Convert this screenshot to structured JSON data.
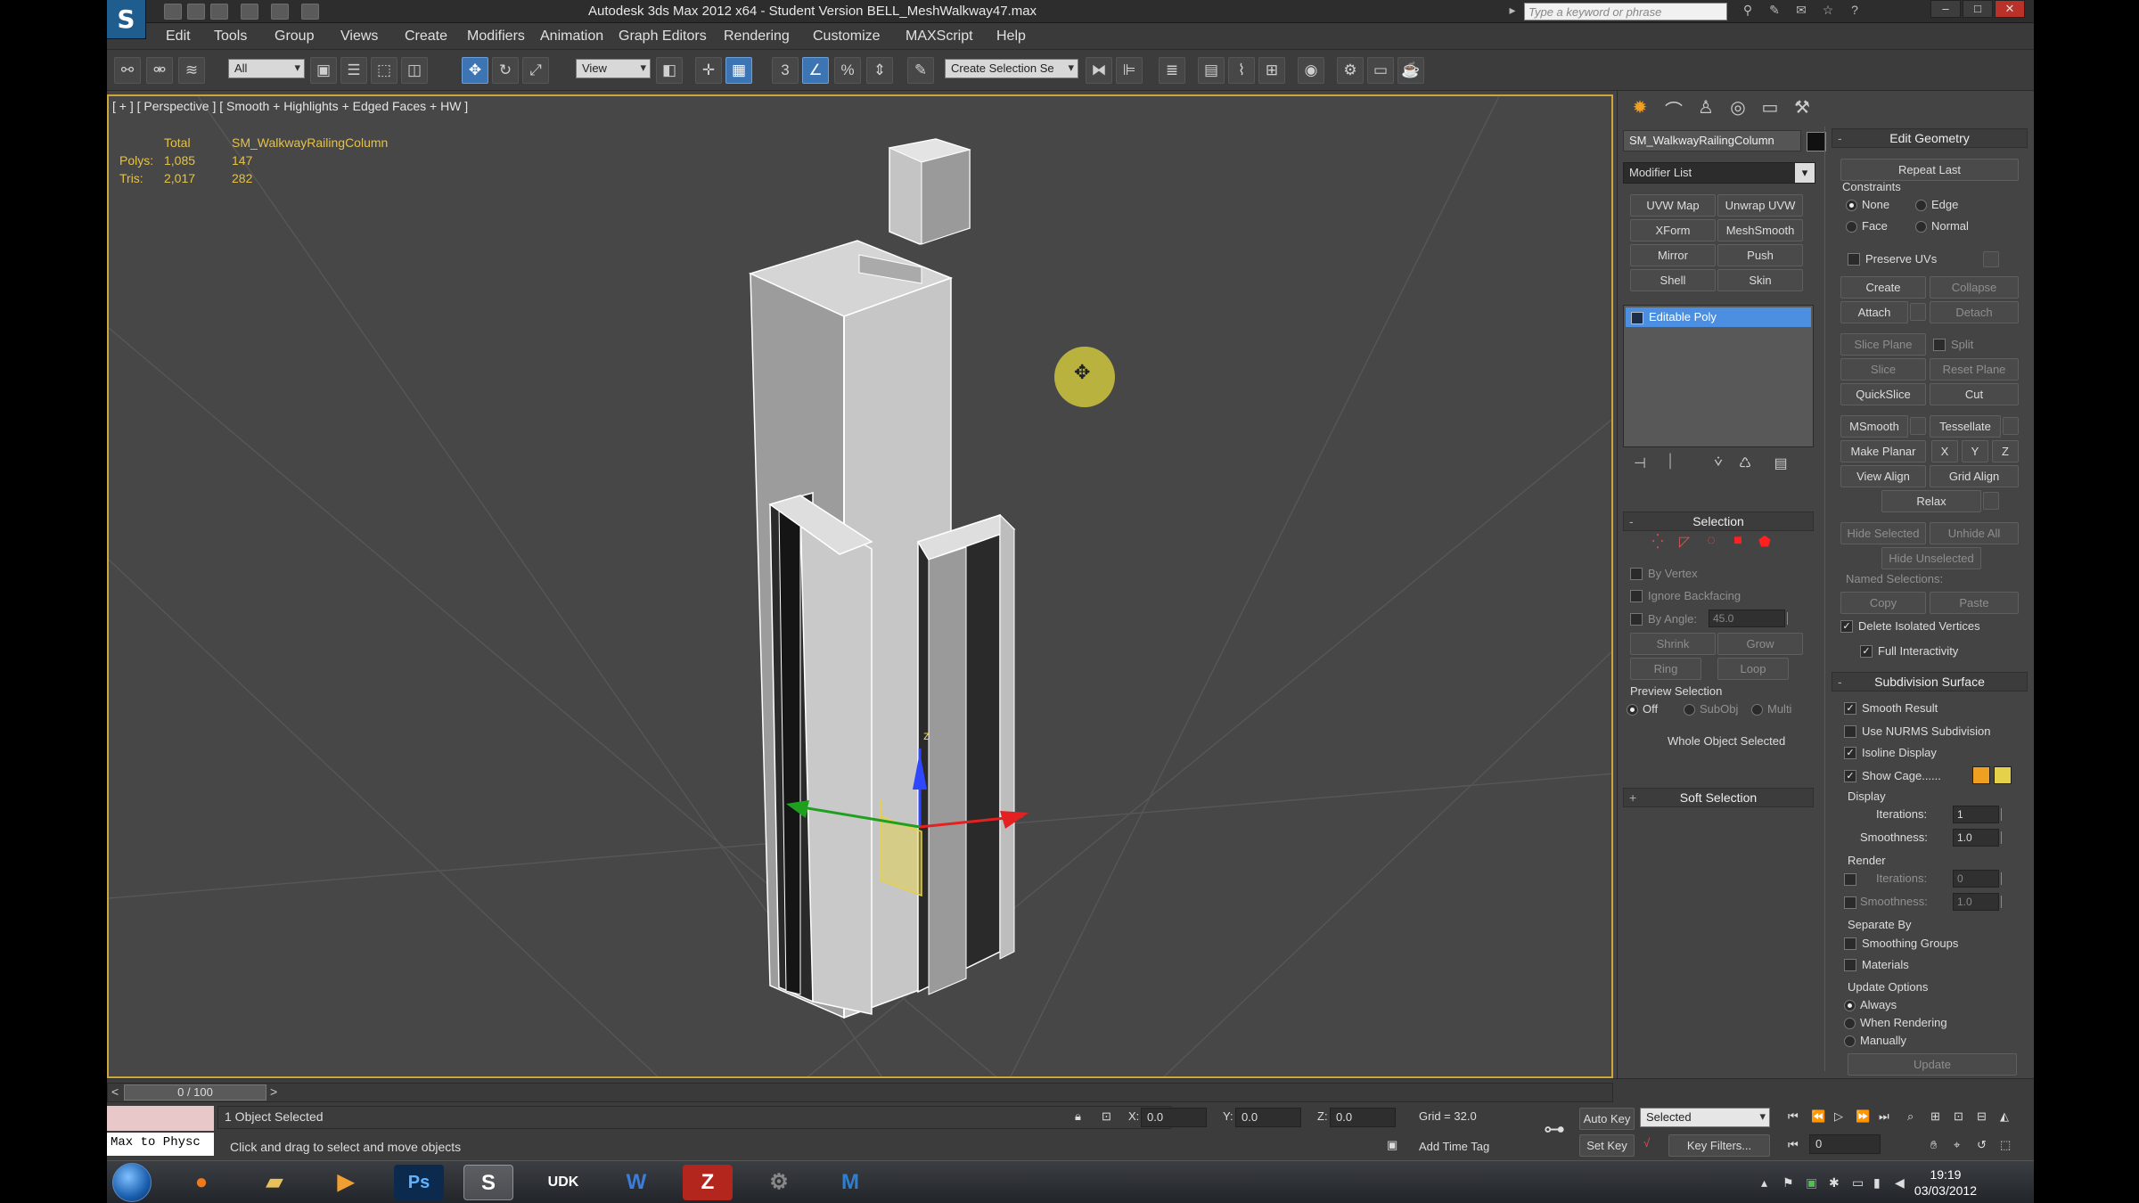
{
  "window": {
    "title": "Autodesk 3ds Max 2012 x64  -  Student Version    BELL_MeshWalkway47.max",
    "search_placeholder": "Type a keyword or phrase"
  },
  "menus": [
    "Edit",
    "Tools",
    "Group",
    "Views",
    "Create",
    "Modifiers",
    "Animation",
    "Graph Editors",
    "Rendering",
    "Customize",
    "MAXScript",
    "Help"
  ],
  "toolbar": {
    "selection_filter": "All",
    "ref_coord": "View",
    "named_selection": "Create Selection Se",
    "snap_label": "3"
  },
  "viewport": {
    "label": "[ + ] [ Perspective ] [ Smooth + Highlights + Edged Faces + HW ]",
    "stats": {
      "header_total": "Total",
      "header_object": "SM_WalkwayRailingColumn",
      "polys_label": "Polys:",
      "polys_total": "1,085",
      "polys_object": "147",
      "tris_label": "Tris:",
      "tris_total": "2,017",
      "tris_object": "282"
    },
    "gizmo_z_label": "z"
  },
  "command_panel": {
    "object_name": "SM_WalkwayRailingColumn",
    "modifier_list": "Modifier List",
    "modifier_buttons": [
      "UVW Map",
      "Unwrap UVW",
      "XForm",
      "MeshSmooth",
      "Mirror",
      "Push",
      "Shell",
      "Skin"
    ],
    "stack_item": "Editable Poly",
    "selection": {
      "title": "Selection",
      "by_vertex": "By Vertex",
      "ignore_backfacing": "Ignore Backfacing",
      "by_angle": "By Angle:",
      "angle_value": "45.0",
      "shrink": "Shrink",
      "grow": "Grow",
      "ring": "Ring",
      "loop": "Loop",
      "preview_title": "Preview Selection",
      "preview_options": [
        "Off",
        "SubObj",
        "Multi"
      ],
      "status": "Whole Object Selected"
    },
    "soft_selection": "Soft Selection",
    "edit_geometry": {
      "title": "Edit Geometry",
      "repeat_last": "Repeat Last",
      "constraints": "Constraints",
      "constraint_options": [
        "None",
        "Edge",
        "Face",
        "Normal"
      ],
      "preserve_uvs": "Preserve UVs",
      "create": "Create",
      "collapse": "Collapse",
      "attach": "Attach",
      "detach": "Detach",
      "slice_plane": "Slice Plane",
      "split": "Split",
      "slice": "Slice",
      "reset_plane": "Reset Plane",
      "quickslice": "QuickSlice",
      "cut": "Cut",
      "msmooth": "MSmooth",
      "tessellate": "Tessellate",
      "make_planar": "Make Planar",
      "x": "X",
      "y": "Y",
      "z": "Z",
      "view_align": "View Align",
      "grid_align": "Grid Align",
      "relax": "Relax",
      "hide_selected": "Hide Selected",
      "unhide_all": "Unhide All",
      "hide_unselected": "Hide Unselected",
      "named_selections": "Named Selections:",
      "copy": "Copy",
      "paste": "Paste",
      "delete_isolated": "Delete Isolated Vertices",
      "full_interactivity": "Full Interactivity"
    },
    "subdivision": {
      "title": "Subdivision Surface",
      "smooth_result": "Smooth Result",
      "use_nurms": "Use NURMS Subdivision",
      "isoline": "Isoline Display",
      "show_cage": "Show Cage......",
      "cage_color_1": "#f0a020",
      "cage_color_2": "#e6d24a",
      "display": "Display",
      "iterations": "Iterations:",
      "iterations_value": "1",
      "smoothness": "Smoothness:",
      "smoothness_value": "1.0",
      "render": "Render",
      "render_iterations_value": "0",
      "render_smoothness_value": "1.0",
      "separate_by": "Separate By",
      "smoothing_groups": "Smoothing Groups",
      "materials": "Materials",
      "update_options": "Update Options",
      "always": "Always",
      "when_rendering": "When Rendering",
      "manually": "Manually",
      "update": "Update"
    }
  },
  "bottom": {
    "time": "0 / 100",
    "listener": "Max to Physc",
    "selected_count": "1 Object Selected",
    "prompt": "Click and drag to select and move objects",
    "x_label": "X:",
    "x": "0.0",
    "y_label": "Y:",
    "y": "0.0",
    "z_label": "Z:",
    "z": "0.0",
    "grid": "Grid = 32.0",
    "add_time_tag": "Add Time Tag",
    "auto_key": "Auto Key",
    "set_key": "Set Key",
    "key_mode": "Selected",
    "key_filters": "Key Filters...",
    "frame": "0"
  },
  "taskbar": {
    "apps": [
      "firefox-icon",
      "explorer-icon",
      "media-player-icon",
      "photoshop-icon",
      "3dsmax-icon",
      "udk-icon",
      "word-icon",
      "filezilla-icon",
      "steam-icon",
      "maya-icon"
    ],
    "time": "19:19",
    "date": "03/03/2012"
  }
}
